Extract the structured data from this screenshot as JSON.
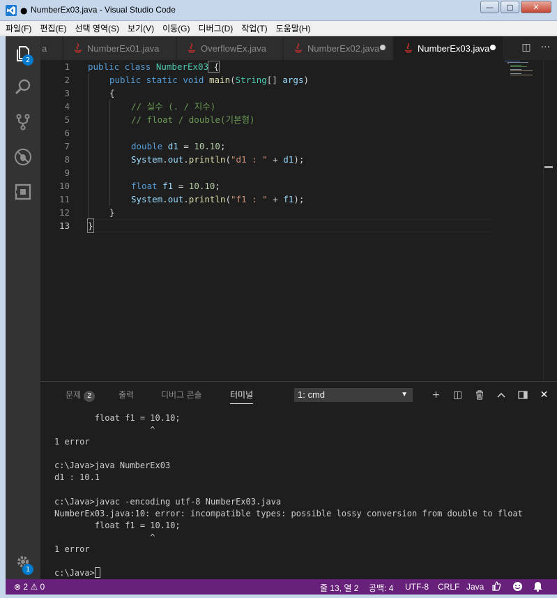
{
  "window": {
    "title": "NumberEx03.java - Visual Studio Code",
    "modified_dot": "●",
    "controls": {
      "minimize": "—",
      "maximize": "▢",
      "close": "✕"
    }
  },
  "menu": [
    "파일(F)",
    "편집(E)",
    "선택 영역(S)",
    "보기(V)",
    "이동(G)",
    "디버그(D)",
    "작업(T)",
    "도움말(H)"
  ],
  "activity_bar": {
    "items": [
      {
        "name": "explorer-icon",
        "badge": "2"
      },
      {
        "name": "search-icon"
      },
      {
        "name": "source-control-icon"
      },
      {
        "name": "debug-icon"
      },
      {
        "name": "extensions-icon"
      }
    ],
    "settings_badge": "1"
  },
  "tabs": {
    "partial_label": "a",
    "items": [
      {
        "label": "NumberEx01.java",
        "dirty": false,
        "active": false
      },
      {
        "label": "OverflowEx.java",
        "dirty": false,
        "active": false
      },
      {
        "label": "NumberEx02.java",
        "dirty": true,
        "active": false
      },
      {
        "label": "NumberEx03.java",
        "dirty": true,
        "active": true
      }
    ],
    "actions": {
      "split": "◫",
      "more": "···"
    }
  },
  "editor": {
    "current_line": "13",
    "line_numbers": [
      "1",
      "2",
      "3",
      "4",
      "5",
      "6",
      "7",
      "8",
      "9",
      "10",
      "11",
      "12",
      "13"
    ],
    "code": {
      "l1_kw": "public class ",
      "l1_cls": "NumberEx03",
      "l1_brace": " {",
      "l2_kw": "public static void ",
      "l2_fn": "main",
      "l2_open": "(",
      "l2_ty": "String",
      "l2_rest": "[] ",
      "l2_var": "args",
      "l2_close": ")",
      "l3": "{",
      "l4": "// 실수 (. / 지수)",
      "l5": "// float / double(기본형)",
      "l7_kw": "double ",
      "l7_var": "d1",
      "l7_eq": " = ",
      "l7_num": "10.10",
      "l7_end": ";",
      "l8_sys": "System",
      "l8_dot": ".",
      "l8_out": "out",
      "l8_dot2": ".",
      "l8_fn": "println",
      "l8_open": "(",
      "l8_str": "\"d1 : \"",
      "l8_plus": " + ",
      "l8_var": "d1",
      "l8_end": ");",
      "l10_kw": "float ",
      "l10_var": "f1",
      "l10_eq": " = ",
      "l10_num": "10.10",
      "l10_end": ";",
      "l11_sys": "System",
      "l11_dot": ".",
      "l11_out": "out",
      "l11_dot2": ".",
      "l11_fn": "println",
      "l11_open": "(",
      "l11_str": "\"f1 : \"",
      "l11_plus": " + ",
      "l11_var": "f1",
      "l11_end": ");",
      "l12": "}",
      "l13": "}"
    }
  },
  "panel": {
    "tabs": [
      {
        "label": "문제",
        "badge": "2"
      },
      {
        "label": "출력"
      },
      {
        "label": "디버그 콘솔"
      },
      {
        "label": "터미널"
      }
    ],
    "terminal_select": "1: cmd",
    "actions": {
      "new": "+",
      "split": "◫",
      "kill": "🗑",
      "maximize": "⌃",
      "toggle": "◨",
      "close": "✕"
    },
    "terminal_lines": [
      "        float f1 = 10.10;",
      "                   ^",
      "1 error",
      "",
      "c:\\Java>java NumberEx03",
      "d1 : 10.1",
      "",
      "c:\\Java>javac -encoding utf-8 NumberEx03.java",
      "NumberEx03.java:10: error: incompatible types: possible lossy conversion from double to float",
      "        float f1 = 10.10;",
      "                   ^",
      "1 error",
      ""
    ],
    "prompt": "c:\\Java>"
  },
  "status": {
    "errors": "2",
    "warnings": "0",
    "position": "줄 13, 열 2",
    "spaces": "공백: 4",
    "encoding": "UTF-8",
    "eol": "CRLF",
    "language": "Java"
  },
  "colors": {
    "status_bar": "#68217a",
    "accent": "#007acc",
    "titlebar": "#c6d7ec"
  }
}
